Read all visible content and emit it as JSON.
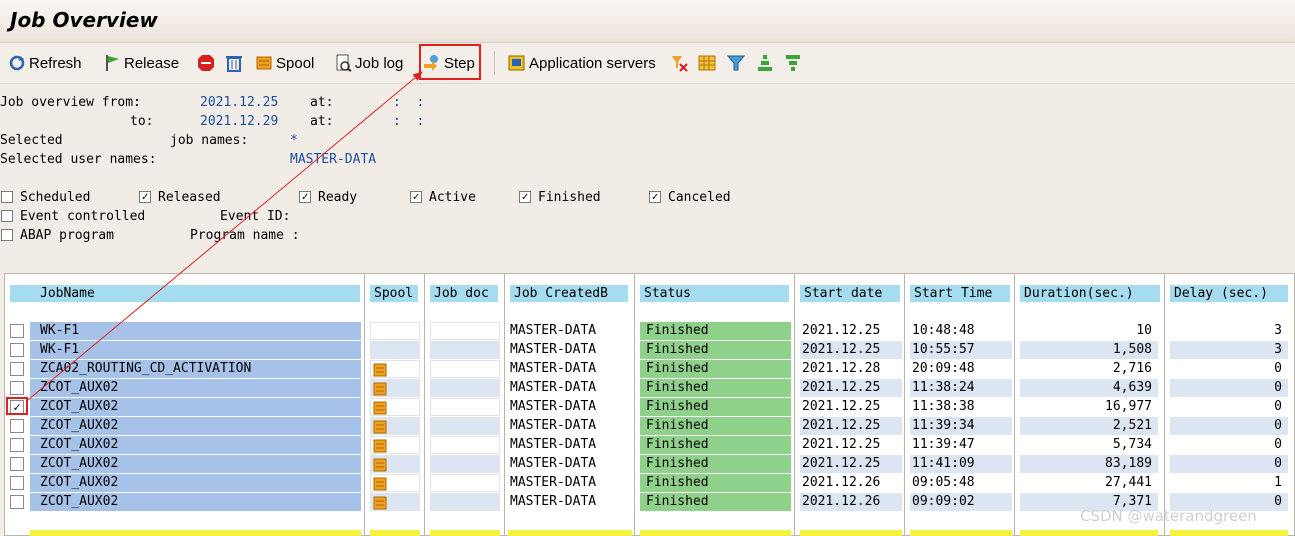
{
  "window": {
    "title": "Job Overview"
  },
  "toolbar": {
    "refresh": "Refresh",
    "release": "Release",
    "spool": "Spool",
    "job_log": "Job log",
    "step": "Step",
    "app_servers": "Application servers",
    "icons": [
      "refresh-icon",
      "release-flag-icon",
      "stop-icon",
      "delete-trash-icon",
      "spool-icon",
      "job-log-icon",
      "step-icon",
      "application-servers-icon",
      "filter-settings-icon",
      "grid-icon",
      "filter-icon",
      "sort-ascending-icon",
      "sort-descending-icon"
    ]
  },
  "criteria": {
    "from_label": "Job overview from:",
    "from_date": "2021.12.25",
    "at_label": "at:",
    "time_placeholder": ":  :",
    "to_label": "to:",
    "to_date": "2021.12.29",
    "selected_label": "Selected",
    "job_names_label": "job names:",
    "job_names_value": "*",
    "user_names_label": "Selected user names:",
    "user_names_value": "MASTER-DATA"
  },
  "status_filters": [
    {
      "label": "Scheduled",
      "checked": false
    },
    {
      "label": "Released",
      "checked": true
    },
    {
      "label": "Ready",
      "checked": true
    },
    {
      "label": "Active",
      "checked": true
    },
    {
      "label": "Finished",
      "checked": true
    },
    {
      "label": "Canceled",
      "checked": true
    }
  ],
  "event_controlled": {
    "label": "Event controlled",
    "checked": false,
    "event_id_label": "Event ID:"
  },
  "abap_program": {
    "label": "ABAP program",
    "checked": false,
    "program_name_label": "Program name :"
  },
  "table": {
    "columns": [
      "JobName",
      "Spool",
      "Job doc",
      "Job CreatedB",
      "Status",
      "Start date",
      "Start Time",
      "Duration(sec.)",
      "Delay (sec.)"
    ],
    "rows": [
      {
        "checked": false,
        "job": "WK-F1",
        "spool": false,
        "created_by": "MASTER-DATA",
        "status": "Finished",
        "start_date": "2021.12.25",
        "start_time": "10:48:48",
        "duration": "10",
        "delay": "3"
      },
      {
        "checked": false,
        "job": "WK-F1",
        "spool": false,
        "created_by": "MASTER-DATA",
        "status": "Finished",
        "start_date": "2021.12.25",
        "start_time": "10:55:57",
        "duration": "1,508",
        "delay": "3"
      },
      {
        "checked": false,
        "job": "ZCA02_ROUTING_CD_ACTIVATION",
        "spool": true,
        "created_by": "MASTER-DATA",
        "status": "Finished",
        "start_date": "2021.12.28",
        "start_time": "20:09:48",
        "duration": "2,716",
        "delay": "0"
      },
      {
        "checked": false,
        "job": "ZCOT_AUX02",
        "spool": true,
        "created_by": "MASTER-DATA",
        "status": "Finished",
        "start_date": "2021.12.25",
        "start_time": "11:38:24",
        "duration": "4,639",
        "delay": "0"
      },
      {
        "checked": true,
        "job": "ZCOT_AUX02",
        "spool": true,
        "created_by": "MASTER-DATA",
        "status": "Finished",
        "start_date": "2021.12.25",
        "start_time": "11:38:38",
        "duration": "16,977",
        "delay": "0"
      },
      {
        "checked": false,
        "job": "ZCOT_AUX02",
        "spool": true,
        "created_by": "MASTER-DATA",
        "status": "Finished",
        "start_date": "2021.12.25",
        "start_time": "11:39:34",
        "duration": "2,521",
        "delay": "0"
      },
      {
        "checked": false,
        "job": "ZCOT_AUX02",
        "spool": true,
        "created_by": "MASTER-DATA",
        "status": "Finished",
        "start_date": "2021.12.25",
        "start_time": "11:39:47",
        "duration": "5,734",
        "delay": "0"
      },
      {
        "checked": false,
        "job": "ZCOT_AUX02",
        "spool": true,
        "created_by": "MASTER-DATA",
        "status": "Finished",
        "start_date": "2021.12.25",
        "start_time": "11:41:09",
        "duration": "83,189",
        "delay": "0"
      },
      {
        "checked": false,
        "job": "ZCOT_AUX02",
        "spool": true,
        "created_by": "MASTER-DATA",
        "status": "Finished",
        "start_date": "2021.12.26",
        "start_time": "09:05:48",
        "duration": "27,441",
        "delay": "1"
      },
      {
        "checked": false,
        "job": "ZCOT_AUX02",
        "spool": true,
        "created_by": "MASTER-DATA",
        "status": "Finished",
        "start_date": "2021.12.26",
        "start_time": "09:09:02",
        "duration": "7,371",
        "delay": "0"
      }
    ]
  },
  "watermark": "CSDN @waterandgreen",
  "colors": {
    "header": "#a6dcef",
    "jobname": "#a6c2e8",
    "status_finished": "#8fd08a",
    "highlight": "#e02020",
    "total_row": "#f4f23c"
  }
}
